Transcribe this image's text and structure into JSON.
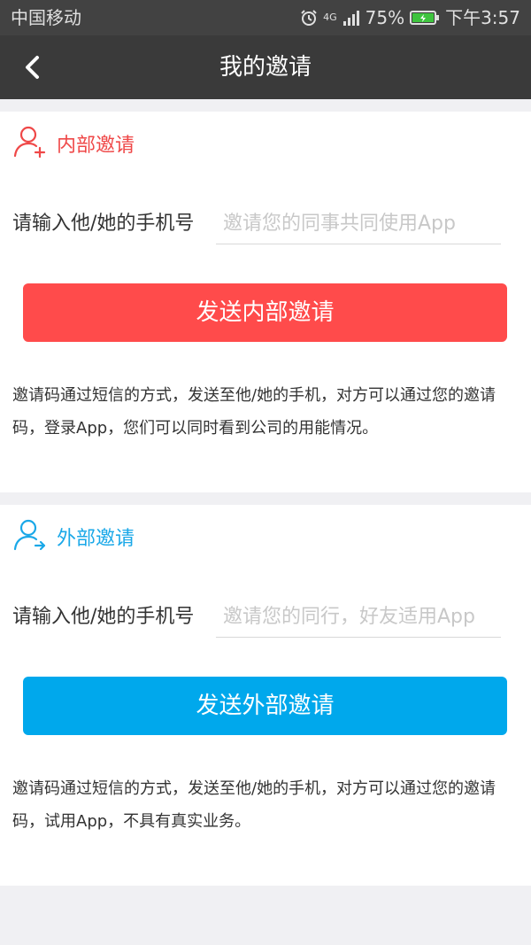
{
  "status_bar": {
    "carrier": "中国移动",
    "network": "4G",
    "battery_percent": "75%",
    "time": "下午3:57"
  },
  "nav": {
    "title": "我的邀请",
    "back_icon": "chevron-left-icon"
  },
  "internal": {
    "title": "内部邀请",
    "icon": "person-add-icon",
    "field_label": "请输入他/她的手机号",
    "placeholder": "邀请您的同事共同使用App",
    "value": "",
    "button_label": "发送内部邀请",
    "description": "邀请码通过短信的方式，发送至他/她的手机，对方可以通过您的邀请码，登录App，您们可以同时看到公司的用能情况。"
  },
  "external": {
    "title": "外部邀请",
    "icon": "person-forward-icon",
    "field_label": "请输入他/她的手机号",
    "placeholder": "邀请您的同行，好友适用App",
    "value": "",
    "button_label": "发送外部邀请",
    "description": "邀请码通过短信的方式，发送至他/她的手机，对方可以通过您的邀请码，试用App，不具有真实业务。"
  },
  "colors": {
    "internal_accent": "#ff4b4b",
    "external_accent": "#00a8ec",
    "navbar": "#3a3a3a"
  }
}
